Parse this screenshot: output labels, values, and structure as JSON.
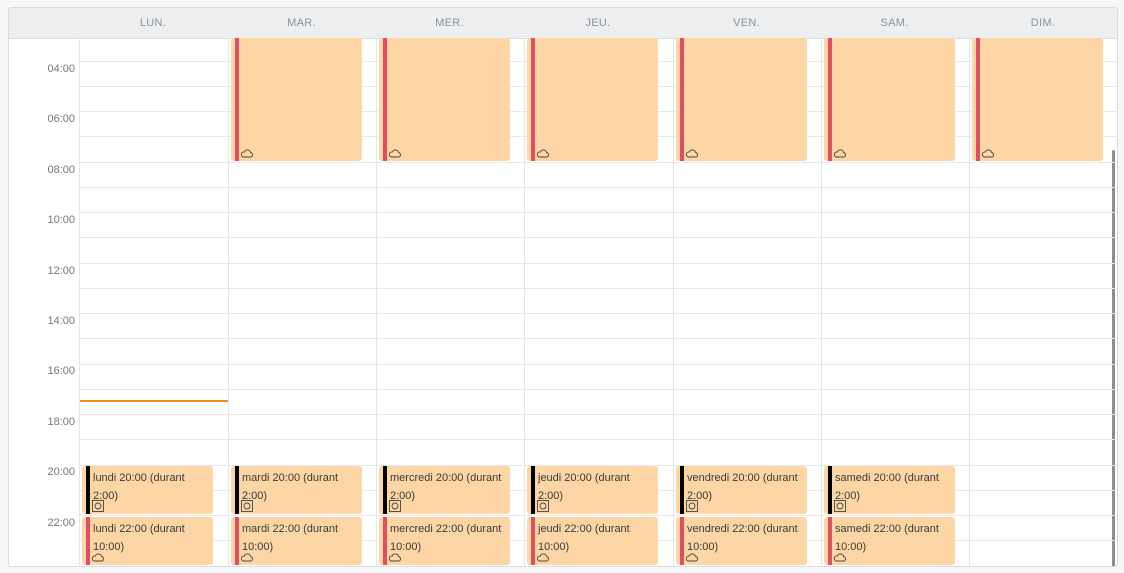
{
  "calendar": {
    "days": [
      "LUN.",
      "MAR.",
      "MER.",
      "JEU.",
      "VEN.",
      "SAM.",
      "DIM."
    ],
    "time_labels": [
      "04:00",
      "06:00",
      "08:00",
      "10:00",
      "12:00",
      "14:00",
      "16:00",
      "18:00",
      "20:00",
      "22:00"
    ],
    "colors": {
      "event_bg": "#fed6a6",
      "sleep_bar": "#e04f5f",
      "work_bar": "#000000",
      "now_line": "#ef8a1c"
    },
    "morning_events": [
      {
        "day": 1,
        "icon": "cloud-icon"
      },
      {
        "day": 2,
        "icon": "cloud-icon"
      },
      {
        "day": 3,
        "icon": "cloud-icon"
      },
      {
        "day": 4,
        "icon": "cloud-icon"
      },
      {
        "day": 5,
        "icon": "cloud-icon"
      },
      {
        "day": 6,
        "icon": "cloud-icon"
      }
    ],
    "evening_events": [
      {
        "day": 0,
        "text": "lundi 20:00 (durant 2:00)",
        "icon": "gear-icon"
      },
      {
        "day": 1,
        "text": "mardi 20:00 (durant 2:00)",
        "icon": "gear-icon"
      },
      {
        "day": 2,
        "text": "mercredi 20:00 (durant 2:00)",
        "icon": "gear-icon"
      },
      {
        "day": 3,
        "text": "jeudi 20:00 (durant 2:00)",
        "icon": "gear-icon"
      },
      {
        "day": 4,
        "text": "vendredi 20:00 (durant 2:00)",
        "icon": "gear-icon"
      },
      {
        "day": 5,
        "text": "samedi 20:00 (durant 2:00)",
        "icon": "gear-icon"
      }
    ],
    "night_events": [
      {
        "day": 0,
        "text": "lundi 22:00 (durant 10:00)",
        "icon": "cloud-icon"
      },
      {
        "day": 1,
        "text": "mardi 22:00 (durant 10:00)",
        "icon": "cloud-icon"
      },
      {
        "day": 2,
        "text": "mercredi 22:00 (durant 10:00)",
        "icon": "cloud-icon"
      },
      {
        "day": 3,
        "text": "jeudi 22:00 (durant 10:00)",
        "icon": "cloud-icon"
      },
      {
        "day": 4,
        "text": "vendredi 22:00 (durant 10:00)",
        "icon": "cloud-icon"
      },
      {
        "day": 5,
        "text": "samedi 22:00 (durant 10:00)",
        "icon": "cloud-icon"
      }
    ]
  }
}
